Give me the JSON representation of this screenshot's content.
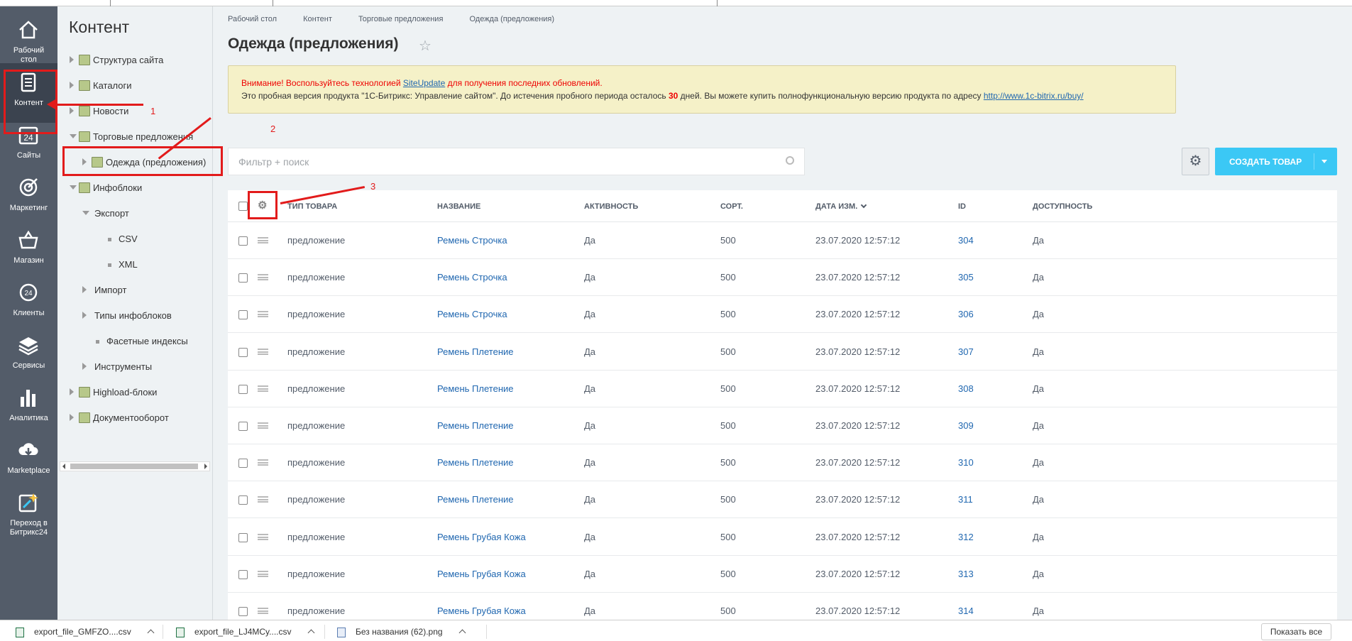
{
  "nav": [
    {
      "name": "nav-desktop",
      "label": "Рабочий\nстол",
      "icon": "home-icon"
    },
    {
      "name": "nav-content",
      "label": "Контент",
      "icon": "document-icon",
      "active": true
    },
    {
      "name": "nav-sites",
      "label": "Сайты",
      "icon": "calendar-24-icon"
    },
    {
      "name": "nav-marketing",
      "label": "Маркетинг",
      "icon": "target-icon"
    },
    {
      "name": "nav-shop",
      "label": "Магазин",
      "icon": "basket-icon"
    },
    {
      "name": "nav-clients",
      "label": "Клиенты",
      "icon": "clients-24-icon"
    },
    {
      "name": "nav-services",
      "label": "Сервисы",
      "icon": "layers-icon"
    },
    {
      "name": "nav-analytics",
      "label": "Аналитика",
      "icon": "bar-chart-icon"
    },
    {
      "name": "nav-marketplace",
      "label": "Marketplace",
      "icon": "cloud-download-icon"
    },
    {
      "name": "nav-bitrix24",
      "label": "Переход в\nБитрикс24",
      "icon": "sparkle-icon"
    }
  ],
  "tree": {
    "title": "Контент",
    "items": [
      {
        "label": "Структура сайта",
        "level": 0,
        "arrow": "right",
        "icon": "sitemap-icon"
      },
      {
        "label": "Каталоги",
        "level": 0,
        "arrow": "right",
        "icon": "catalog-icon"
      },
      {
        "label": "Новости",
        "level": 0,
        "arrow": "right",
        "icon": "news-icon"
      },
      {
        "label": "Торговые предложения",
        "level": 0,
        "arrow": "down",
        "icon": "offers-icon"
      },
      {
        "label": "Одежда (предложения)",
        "level": 1,
        "arrow": "right",
        "icon": "iblock-icon"
      },
      {
        "label": "Инфоблоки",
        "level": 0,
        "arrow": "down",
        "icon": "infoblocks-icon"
      },
      {
        "label": "Экспорт",
        "level": 1,
        "arrow": "down"
      },
      {
        "label": "CSV",
        "level": 2,
        "arrow": "dot"
      },
      {
        "label": "XML",
        "level": 2,
        "arrow": "dot"
      },
      {
        "label": "Импорт",
        "level": 1,
        "arrow": "right"
      },
      {
        "label": "Типы инфоблоков",
        "level": 1,
        "arrow": "right"
      },
      {
        "label": "Фасетные индексы",
        "level": 1,
        "arrow": "dot"
      },
      {
        "label": "Инструменты",
        "level": 1,
        "arrow": "right"
      },
      {
        "label": "Highload-блоки",
        "level": 0,
        "arrow": "right",
        "icon": "highload-icon"
      },
      {
        "label": "Документооборот",
        "level": 0,
        "arrow": "right",
        "icon": "workflow-icon"
      }
    ]
  },
  "breadcrumbs": [
    "Рабочий стол",
    "Контент",
    "Торговые предложения",
    "Одежда (предложения)"
  ],
  "page_title": "Одежда (предложения)",
  "notice": {
    "line1_red": "Внимание! Воспользуйтесь технологией",
    "line1_link": "SiteUpdate",
    "line1_rest": "для получения последних обновлений.",
    "line2_pre": "Это пробная версия продукта \"1С-Битрикс: Управление сайтом\". До истечения пробного периода осталось",
    "line2_days": "30",
    "line2_mid": "дней. Вы можете купить полнофункциональную версию продукта по адресу",
    "line2_link": "http://www.1c-bitrix.ru/buy/"
  },
  "filter_placeholder": "Фильтр + поиск",
  "create_button": "СОЗДАТЬ ТОВАР",
  "columns": [
    "ТИП ТОВАРА",
    "НАЗВАНИЕ",
    "АКТИВНОСТЬ",
    "СОРТ.",
    "ДАТА ИЗМ.",
    "ID",
    "ДОСТУПНОСТЬ"
  ],
  "rows": [
    {
      "type": "предложение",
      "name": "Ремень Строчка",
      "active": "Да",
      "sort": "500",
      "date": "23.07.2020 12:57:12",
      "id": "304",
      "avail": "Да"
    },
    {
      "type": "предложение",
      "name": "Ремень Строчка",
      "active": "Да",
      "sort": "500",
      "date": "23.07.2020 12:57:12",
      "id": "305",
      "avail": "Да"
    },
    {
      "type": "предложение",
      "name": "Ремень Строчка",
      "active": "Да",
      "sort": "500",
      "date": "23.07.2020 12:57:12",
      "id": "306",
      "avail": "Да"
    },
    {
      "type": "предложение",
      "name": "Ремень Плетение",
      "active": "Да",
      "sort": "500",
      "date": "23.07.2020 12:57:12",
      "id": "307",
      "avail": "Да"
    },
    {
      "type": "предложение",
      "name": "Ремень Плетение",
      "active": "Да",
      "sort": "500",
      "date": "23.07.2020 12:57:12",
      "id": "308",
      "avail": "Да"
    },
    {
      "type": "предложение",
      "name": "Ремень Плетение",
      "active": "Да",
      "sort": "500",
      "date": "23.07.2020 12:57:12",
      "id": "309",
      "avail": "Да"
    },
    {
      "type": "предложение",
      "name": "Ремень Плетение",
      "active": "Да",
      "sort": "500",
      "date": "23.07.2020 12:57:12",
      "id": "310",
      "avail": "Да"
    },
    {
      "type": "предложение",
      "name": "Ремень Плетение",
      "active": "Да",
      "sort": "500",
      "date": "23.07.2020 12:57:12",
      "id": "311",
      "avail": "Да"
    },
    {
      "type": "предложение",
      "name": "Ремень Грубая Кожа",
      "active": "Да",
      "sort": "500",
      "date": "23.07.2020 12:57:12",
      "id": "312",
      "avail": "Да"
    },
    {
      "type": "предложение",
      "name": "Ремень Грубая Кожа",
      "active": "Да",
      "sort": "500",
      "date": "23.07.2020 12:57:12",
      "id": "313",
      "avail": "Да"
    },
    {
      "type": "предложение",
      "name": "Ремень Грубая Кожа",
      "active": "Да",
      "sort": "500",
      "date": "23.07.2020 12:57:12",
      "id": "314",
      "avail": "Да"
    }
  ],
  "annotations": [
    "1",
    "2",
    "3"
  ],
  "downloads": [
    {
      "label": "export_file_GMFZO....csv",
      "kind": "csv"
    },
    {
      "label": "export_file_LJ4MCy....csv",
      "kind": "csv"
    },
    {
      "label": "Без названия (62).png",
      "kind": "png"
    }
  ],
  "show_all": "Показать все",
  "colors": {
    "accent": "#3bc8f5",
    "nav_bg": "#535c69",
    "annotation": "#e21b1b",
    "link": "#2067b0"
  }
}
